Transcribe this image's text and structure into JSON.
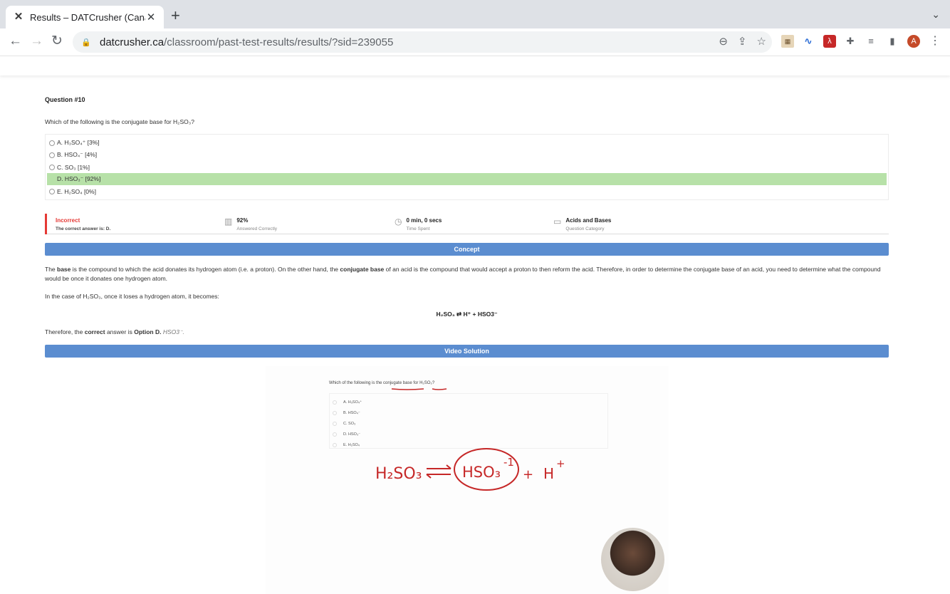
{
  "browser": {
    "tab_title": "Results – DATCrusher (Canadia",
    "url_host": "datcrusher.ca",
    "url_path": "/classroom/past-test-results/results/?sid=239055",
    "avatar_letter": "A"
  },
  "question": {
    "number": "Question #10",
    "text": "Which of the following is the conjugate base for H₂SO₃?",
    "options": [
      {
        "label": "A. H₃SO₄⁺ [3%]",
        "correct": false
      },
      {
        "label": "B. HSO₄⁻ [4%]",
        "correct": false
      },
      {
        "label": "C. SO₃ [1%]",
        "correct": false
      },
      {
        "label": "D. HSO₃⁻ [92%]",
        "correct": true
      },
      {
        "label": "E. H₂SO₄ [0%]",
        "correct": false
      }
    ]
  },
  "stats": {
    "status": "Incorrect",
    "correct_answer": "The correct answer is: D.",
    "percent": "92%",
    "percent_label": "Answered Correctly",
    "time": "0 min, 0 secs",
    "time_label": "Time Spent",
    "category": "Acids and Bases",
    "category_label": "Question Category"
  },
  "concept": {
    "heading": "Concept",
    "p1_a": "The ",
    "p1_b": "base",
    "p1_c": " is the compound to which the acid donates its hydrogen atom (i.e. a proton). On the other hand, the ",
    "p1_d": "conjugate base",
    "p1_e": " of an acid is the compound that would accept a proton to then reform the acid. Therefore, in order to determine the conjugate base of an acid, you need to determine what the compound would be once it donates one hydrogen atom.",
    "p2": "In the case of H₂SO₃, once it loses a hydrogen atom, it becomes:",
    "equation": "H₂SO₃ ⇄ H⁺ + HSO3⁻",
    "p3_a": "Therefore, the ",
    "p3_b": "correct",
    "p3_c": " answer is ",
    "p3_d": "Option D.",
    "p3_e": " HSO3⁻."
  },
  "video": {
    "heading": "Video Solution",
    "question": "Which of the following is the conjugate base for H₂SO₃?",
    "options": [
      "A. H₃SO₄⁺",
      "B. HSO₄⁻",
      "C. SO₃",
      "D. HSO₃⁻",
      "E. H₂SO₄"
    ],
    "handwriting": {
      "left": "H₂SO₃",
      "circled": "HSO₃",
      "exponent": "-1",
      "plus": "+",
      "right": "H",
      "right_sup": "+"
    }
  },
  "colors": {
    "correct_bg": "#b7e1a8",
    "bar": "#5b8dd0",
    "incorrect": "#e53935",
    "ink": "#c62828"
  }
}
